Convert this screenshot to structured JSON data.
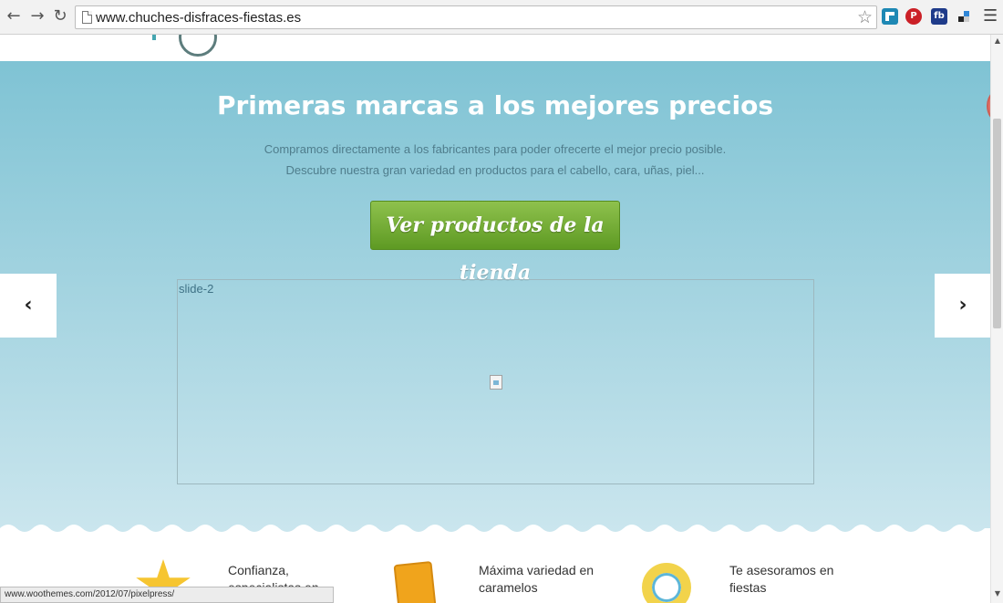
{
  "browser": {
    "url": "www.chuches-disfraces-fiestas.es",
    "status_url": "www.woothemes.com/2012/07/pixelpress/",
    "icons": {
      "back": "back-arrow-icon",
      "forward": "forward-arrow-icon",
      "reload": "reload-icon",
      "bookmark": "star-icon",
      "menu": "hamburger-menu-icon"
    },
    "extensions": [
      {
        "name": "flipboard-extension-icon",
        "color": "#1e88b4",
        "glyph": ""
      },
      {
        "name": "pinterest-extension-icon",
        "color": "#cb2027",
        "glyph": "P"
      },
      {
        "name": "fb-extension-icon",
        "color": "#1f3b8a",
        "glyph": "fb"
      },
      {
        "name": "delicious-extension-icon",
        "color": "#2f86d6",
        "glyph": ""
      }
    ]
  },
  "hero": {
    "title": "Primeras marcas a los mejores precios",
    "subtitle_line1": "Compramos directamente a los fabricantes para poder ofrecerte el mejor precio posible.",
    "subtitle_line2": "Descubre nuestra gran variedad en productos para el cabello, cara, uñas, piel...",
    "cta_label": "Ver productos de la tienda",
    "slide_label": "slide-2",
    "colors": {
      "cta": "#6fa831",
      "background": "#8fcad8"
    }
  },
  "features": [
    {
      "line1": "Confianza,",
      "line2": "especialistas en",
      "icon": "star-icon"
    },
    {
      "line1": "Máxima variedad en",
      "line2": "caramelos",
      "icon": "candy-box-icon"
    },
    {
      "line1": "Te asesoramos en",
      "line2": "fiestas",
      "icon": "swim-ring-icon"
    }
  ]
}
